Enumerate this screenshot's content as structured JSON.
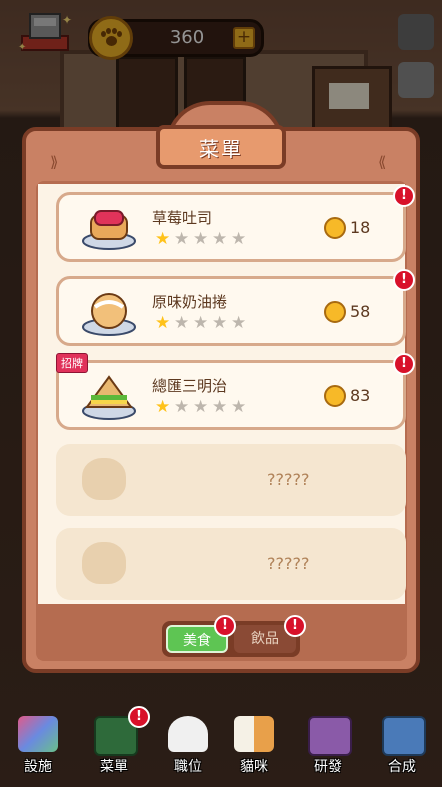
{
  "currency": {
    "amount": "360",
    "add_label": "+"
  },
  "panel": {
    "title": "菜單"
  },
  "menu_items": [
    {
      "name": "草莓吐司",
      "stars": 1,
      "max_stars": 5,
      "price": "18",
      "alert": true,
      "badge": ""
    },
    {
      "name": "原味奶油捲",
      "stars": 1,
      "max_stars": 5,
      "price": "58",
      "alert": true,
      "badge": ""
    },
    {
      "name": "總匯三明治",
      "stars": 1,
      "max_stars": 5,
      "price": "83",
      "alert": true,
      "badge": "招牌"
    }
  ],
  "locked_items": [
    {
      "name": "?????"
    },
    {
      "name": "?????"
    }
  ],
  "tabs": [
    {
      "label": "美食",
      "active": true,
      "alert": true
    },
    {
      "label": "飲品",
      "active": false,
      "alert": true
    }
  ],
  "nav": [
    {
      "label": "設施",
      "icon": "facility-icon"
    },
    {
      "label": "菜單",
      "icon": "menu-book-icon",
      "alert": true
    },
    {
      "label": "職位",
      "icon": "chef-hat-icon"
    },
    {
      "label": "貓咪",
      "icon": "cat-icon"
    },
    {
      "label": "研發",
      "icon": "research-pot-icon"
    },
    {
      "label": "合成",
      "icon": "craft-icon"
    }
  ],
  "colors": {
    "accent": "#c98164",
    "coin": "#f7b928",
    "active_tab": "#5ec553",
    "alert": "#d8112a"
  }
}
